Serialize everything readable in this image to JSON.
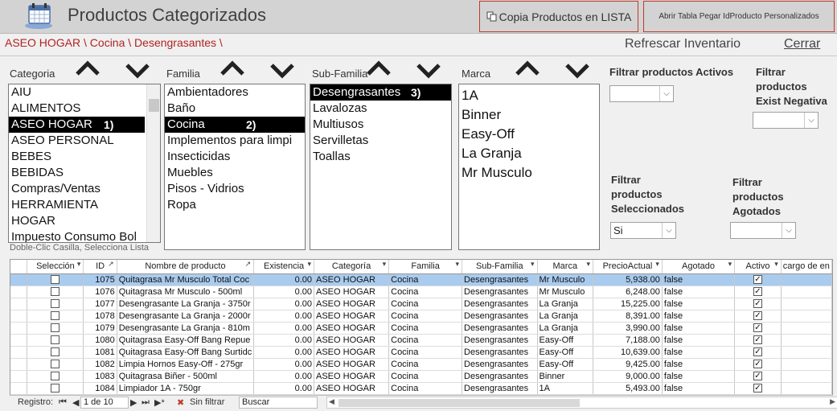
{
  "app": {
    "title": "Productos Categorizados",
    "copy_button": "Copia Productos en LISTA",
    "open_button": "Abrir Tabla Pegar IdProducto Personalizados",
    "breadcrumb": "ASEO HOGAR \\ Cocina \\ Desengrasantes \\",
    "refresh": "Refrescar Inventario",
    "close": "Cerrar"
  },
  "filters": {
    "categoria": {
      "label": "Categoria",
      "items": [
        "AIU",
        "ALIMENTOS",
        "ASEO HOGAR",
        "ASEO PERSONAL",
        "BEBES",
        "BEBIDAS",
        "Compras/Ventas",
        "HERRAMIENTA",
        "HOGAR",
        "Impuesto Consumo Bol"
      ],
      "selected_mark": "1)"
    },
    "familia": {
      "label": "Familia",
      "items": [
        "Ambientadores",
        "Baño",
        "Cocina",
        "Implementos para limpi",
        "Insecticidas",
        "Muebles",
        "Pisos - Vidrios",
        "Ropa"
      ],
      "selected_mark": "2)"
    },
    "subfamilia": {
      "label": "Sub-Familia",
      "items": [
        "Desengrasantes",
        "Lavalozas",
        "Multiusos",
        "Servilletas",
        "Toallas"
      ],
      "selected_mark": "3)"
    },
    "marca": {
      "label": "Marca",
      "items": [
        "1A",
        "Binner",
        "Easy-Off",
        "La Granja",
        "Mr Musculo"
      ]
    },
    "hint": "Doble-Clic Casilla, Selecciona Lista",
    "activos": {
      "label": "Filtrar productos Activos",
      "value": ""
    },
    "exist_negativa": {
      "label": "Filtrar productos Exist Negativa",
      "line1": "Filtrar",
      "line2": "productos",
      "line3": "Exist Negativa",
      "value": ""
    },
    "seleccionados": {
      "line1": "Filtrar",
      "line2": "productos",
      "line3": "Seleccionados",
      "value": "Si"
    },
    "agotados": {
      "line1": "Filtrar",
      "line2": "productos",
      "line3": "Agotados",
      "value": ""
    }
  },
  "grid": {
    "columns": [
      "Selección",
      "ID",
      "Nombre de producto",
      "Existencia",
      "Categoría",
      "Familia",
      "Sub-Familia",
      "Marca",
      "PrecioActual",
      "Agotado",
      "Activo",
      "cargo de en"
    ],
    "rows": [
      {
        "id": "1075",
        "name": "Quitagrasa Mr Musculo Total Coc",
        "exist": "0.00",
        "cat": "ASEO HOGAR",
        "fam": "Cocina",
        "sub": "Desengrasantes",
        "marca": "Mr Musculo",
        "precio": "5,938.00",
        "agotado": "false"
      },
      {
        "id": "1076",
        "name": "Quitagrasa Mr Musculo - 500ml",
        "exist": "0.00",
        "cat": "ASEO HOGAR",
        "fam": "Cocina",
        "sub": "Desengrasantes",
        "marca": "Mr Musculo",
        "precio": "6,248.00",
        "agotado": "false"
      },
      {
        "id": "1077",
        "name": "Desengrasante La Granja - 3750r",
        "exist": "0.00",
        "cat": "ASEO HOGAR",
        "fam": "Cocina",
        "sub": "Desengrasantes",
        "marca": "La Granja",
        "precio": "15,225.00",
        "agotado": "false"
      },
      {
        "id": "1078",
        "name": "Desengrasante La Granja - 2000r",
        "exist": "0.00",
        "cat": "ASEO HOGAR",
        "fam": "Cocina",
        "sub": "Desengrasantes",
        "marca": "La Granja",
        "precio": "8,391.00",
        "agotado": "false"
      },
      {
        "id": "1079",
        "name": "Desengrasante La Granja - 810m",
        "exist": "0.00",
        "cat": "ASEO HOGAR",
        "fam": "Cocina",
        "sub": "Desengrasantes",
        "marca": "La Granja",
        "precio": "3,990.00",
        "agotado": "false"
      },
      {
        "id": "1080",
        "name": "Quitagrasa Easy-Off Bang Repue",
        "exist": "0.00",
        "cat": "ASEO HOGAR",
        "fam": "Cocina",
        "sub": "Desengrasantes",
        "marca": "Easy-Off",
        "precio": "7,188.00",
        "agotado": "false"
      },
      {
        "id": "1081",
        "name": "Quitagrasa Easy-Off Bang Surtidc",
        "exist": "0.00",
        "cat": "ASEO HOGAR",
        "fam": "Cocina",
        "sub": "Desengrasantes",
        "marca": "Easy-Off",
        "precio": "10,639.00",
        "agotado": "false"
      },
      {
        "id": "1082",
        "name": "Limpia Hornos Easy-Off - 275gr",
        "exist": "0.00",
        "cat": "ASEO HOGAR",
        "fam": "Cocina",
        "sub": "Desengrasantes",
        "marca": "Easy-Off",
        "precio": "9,425.00",
        "agotado": "false"
      },
      {
        "id": "1083",
        "name": "Quitagrasa Biñer - 500ml",
        "exist": "0.00",
        "cat": "ASEO HOGAR",
        "fam": "Cocina",
        "sub": "Desengrasantes",
        "marca": "Binner",
        "precio": "9,000.00",
        "agotado": "false"
      },
      {
        "id": "1084",
        "name": "Limpiador 1A - 750gr",
        "exist": "0.00",
        "cat": "ASEO HOGAR",
        "fam": "Cocina",
        "sub": "Desengrasantes",
        "marca": "1A",
        "precio": "5,493.00",
        "agotado": "false"
      }
    ]
  },
  "navigator": {
    "label": "Registro:",
    "position": "1 de 10",
    "filter": "Sin filtrar",
    "search": "Buscar"
  },
  "colors": {
    "accent_red": "#c0392b",
    "header_bg": "#d3d3d3",
    "selected_row": "#a9cbee"
  }
}
